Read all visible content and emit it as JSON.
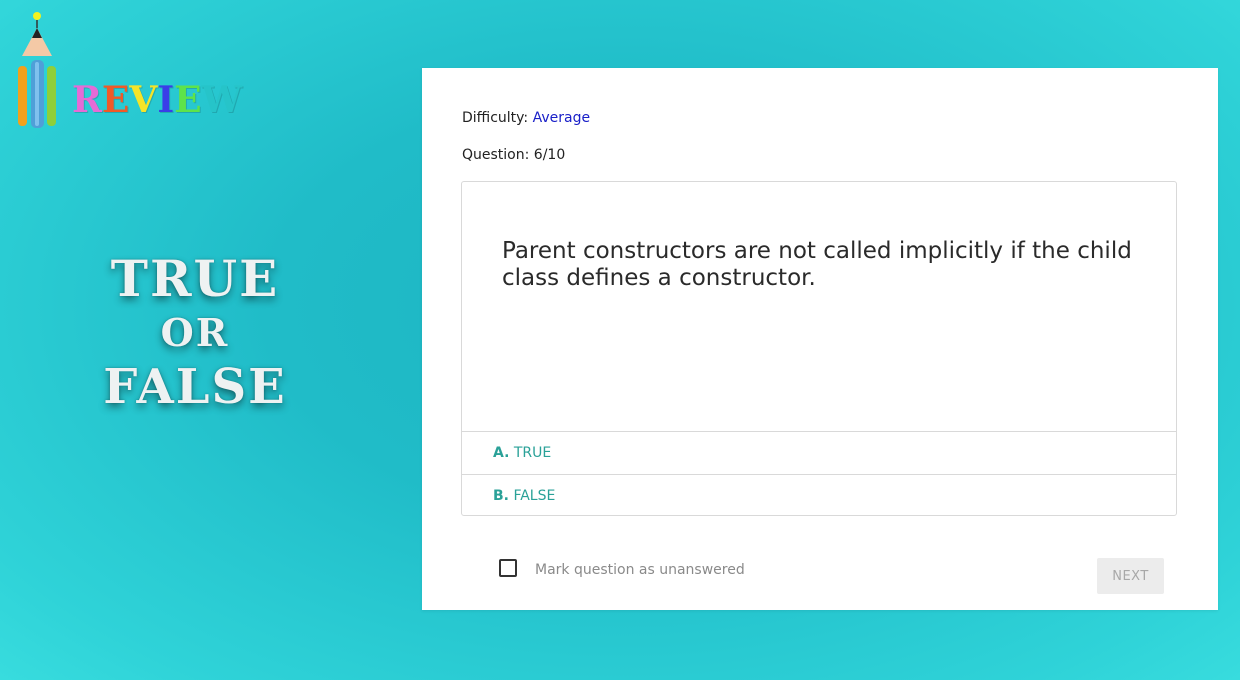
{
  "logo": {
    "letters": [
      {
        "char": "R",
        "color": "#e56bd6"
      },
      {
        "char": "E",
        "color": "#f05a28"
      },
      {
        "char": "V",
        "color": "#f5e428"
      },
      {
        "char": "I",
        "color": "#3a3ee8"
      },
      {
        "char": "E",
        "color": "#5ee34a"
      },
      {
        "char": "W",
        "color": "#26c4c9"
      }
    ]
  },
  "title": {
    "line1": "TRUE",
    "line2": "OR",
    "line3": "FALSE"
  },
  "quiz": {
    "difficulty_label": "Difficulty:",
    "difficulty_value": "Average",
    "question_label": "Question:",
    "question_progress": "6/10",
    "question_text": "Parent constructors are not called implicitly if the child class defines a constructor.",
    "options": [
      {
        "letter": "A.",
        "text": "TRUE"
      },
      {
        "letter": "B.",
        "text": "FALSE"
      }
    ],
    "mark_unanswered_label": "Mark question as unanswered",
    "mark_unanswered_checked": false,
    "next_label": "NEXT"
  },
  "colors": {
    "background": "#22bcc6",
    "option_accent": "#2aa198",
    "difficulty_value": "#1a20c8"
  }
}
